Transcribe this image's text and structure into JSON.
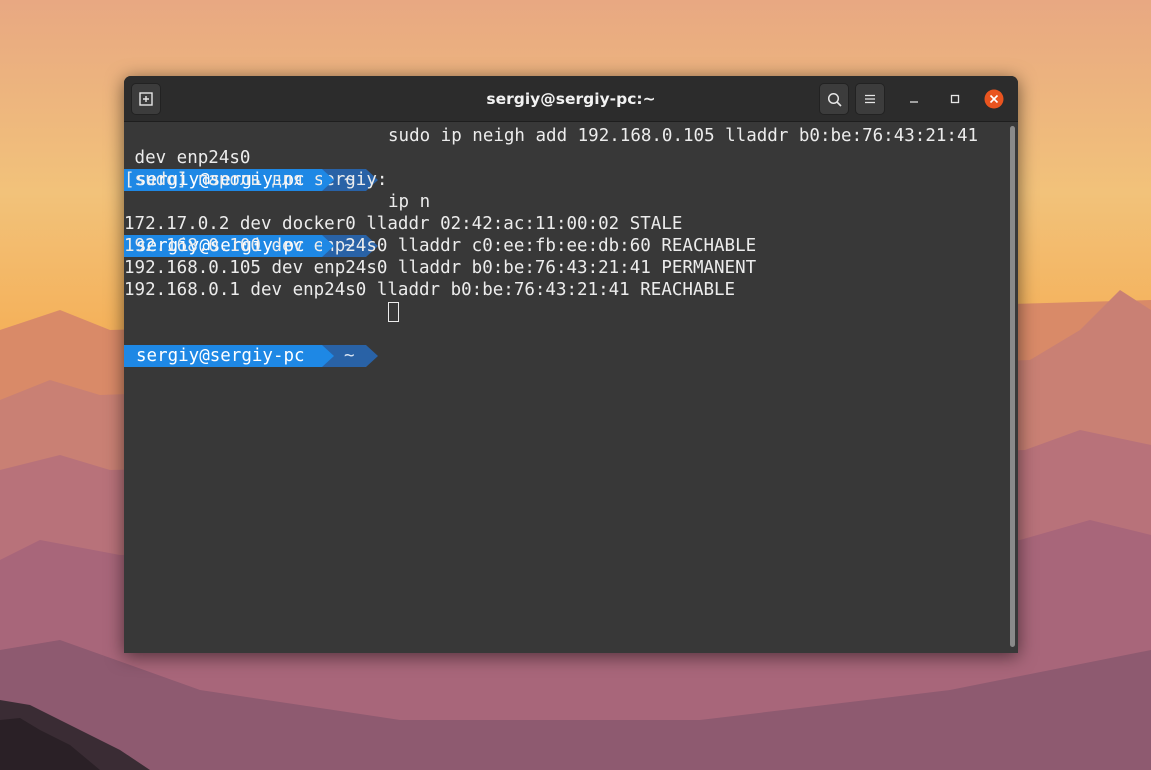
{
  "window": {
    "title": "sergiy@sergiy-pc:~"
  },
  "titlebar": {
    "new_tab_icon": "new-tab-icon",
    "search_icon": "search-icon",
    "menu_icon": "hamburger-menu-icon",
    "minimize_icon": "minimize-icon",
    "maximize_icon": "maximize-icon",
    "close_icon": "close-icon"
  },
  "prompt": {
    "user_host": "sergiy@sergiy-pc",
    "dir": "~"
  },
  "terminal": {
    "lines": [
      {
        "type": "prompt",
        "cmd": "sudo ip neigh add 192.168.0.105 lladdr b0:be:76:43:21:41"
      },
      {
        "type": "output",
        "text": " dev enp24s0"
      },
      {
        "type": "output",
        "text": "[sudo] пароль для sergiy:"
      },
      {
        "type": "prompt",
        "cmd": "ip n"
      },
      {
        "type": "output",
        "text": "172.17.0.2 dev docker0 lladdr 02:42:ac:11:00:02 STALE"
      },
      {
        "type": "output",
        "text": "192.168.0.100 dev enp24s0 lladdr c0:ee:fb:ee:db:60 REACHABLE"
      },
      {
        "type": "output",
        "text": "192.168.0.105 dev enp24s0 lladdr b0:be:76:43:21:41 PERMANENT"
      },
      {
        "type": "output",
        "text": "192.168.0.1 dev enp24s0 lladdr b0:be:76:43:21:41 REACHABLE"
      },
      {
        "type": "prompt",
        "cmd": "",
        "cursor": true
      }
    ]
  },
  "colors": {
    "prompt_user_bg": "#1e88e5",
    "prompt_dir_bg": "#2962a6",
    "terminal_bg": "#383838",
    "titlebar_bg": "#2c2c2c",
    "close_button": "#e9541f",
    "text": "#ececec"
  }
}
